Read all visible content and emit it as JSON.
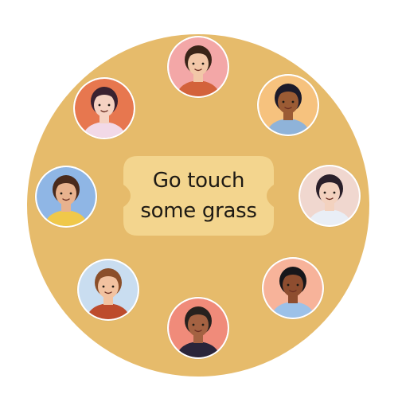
{
  "message": {
    "line1": "Go touch",
    "line2": "some grass"
  },
  "colors": {
    "circle": "#e6bb6b",
    "bubble": "#f3d58e",
    "text": "#1e1a14"
  },
  "avatars": [
    {
      "icon": "person-icon",
      "bg": "#f3a7a7",
      "skin": "#f2c7a8",
      "hair": "#3a2418",
      "shirt": "#d3623b"
    },
    {
      "icon": "person-icon",
      "bg": "#f6c27e",
      "skin": "#9b5b34",
      "hair": "#1c1a2a",
      "shirt": "#8fb3d9"
    },
    {
      "icon": "person-icon",
      "bg": "#f0d7cf",
      "skin": "#f3d2bf",
      "hair": "#2a1f2a",
      "shirt": "#e9eef6"
    },
    {
      "icon": "person-icon",
      "bg": "#f7b39a",
      "skin": "#8e4d2f",
      "hair": "#17161a",
      "shirt": "#9cc1e8"
    },
    {
      "icon": "person-icon",
      "bg": "#f08b7a",
      "skin": "#a46242",
      "hair": "#27211e",
      "shirt": "#2a253a"
    },
    {
      "icon": "person-icon",
      "bg": "#c9ddf0",
      "skin": "#f2c2a0",
      "hair": "#8b4f2a",
      "shirt": "#bd4b2c"
    },
    {
      "icon": "person-icon",
      "bg": "#8fb6e5",
      "skin": "#e8b28e",
      "hair": "#4a2a1c",
      "shirt": "#f0c84a"
    },
    {
      "icon": "person-icon",
      "bg": "#e7774f",
      "skin": "#f5d2c2",
      "hair": "#3a2230",
      "shirt": "#f2d9e7"
    }
  ]
}
